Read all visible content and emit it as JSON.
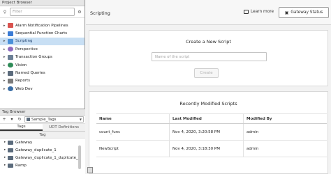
{
  "project_browser": {
    "title": "Project Browser",
    "filter_placeholder": "Filter",
    "items": [
      {
        "label": "Alarm Notification Pipelines",
        "icon": "alarm-pipeline-icon",
        "color": "#d9534f"
      },
      {
        "label": "Sequential Function Charts",
        "icon": "sfc-icon",
        "color": "#3a7bd5"
      },
      {
        "label": "Scripting",
        "icon": "scripting-icon",
        "color": "#4a90d9"
      },
      {
        "label": "Perspective",
        "icon": "perspective-icon",
        "color": "#8e6bbf"
      },
      {
        "label": "Transaction Groups",
        "icon": "transaction-groups-icon",
        "color": "#6b7f95"
      },
      {
        "label": "Vision",
        "icon": "vision-icon",
        "color": "#2e8b57"
      },
      {
        "label": "Named Queries",
        "icon": "named-queries-icon",
        "color": "#5b6b7c"
      },
      {
        "label": "Reports",
        "icon": "reports-icon",
        "color": "#7a7a7a"
      },
      {
        "label": "Web Dev",
        "icon": "web-dev-icon",
        "color": "#3b6ea5"
      }
    ],
    "selected": "Scripting"
  },
  "tag_browser": {
    "title": "Tag Browser",
    "provider": "Sample_Tags",
    "tabs": [
      "Tags",
      "UDT Definitions"
    ],
    "column": "Tag",
    "items": [
      "Gateway",
      "Gateway_duplicate_1",
      "Gateway_duplicate_1_duplicate_1",
      "Ramp"
    ]
  },
  "main": {
    "title": "Scripting",
    "learn_more": "Learn more",
    "gateway_status": "Gateway Status",
    "create": {
      "title": "Create a New Script",
      "placeholder": "Name of the script",
      "button": "Create"
    },
    "recent": {
      "title": "Recently Modified Scripts",
      "columns": [
        "Name",
        "Last Modified",
        "Modified By"
      ],
      "rows": [
        {
          "name": "count_func",
          "modified": "Nov 4, 2020, 3:20:58 PM",
          "by": "admin"
        },
        {
          "name": "NewScript",
          "modified": "Nov 4, 2020, 3:18:30 PM",
          "by": "admin"
        }
      ]
    }
  }
}
